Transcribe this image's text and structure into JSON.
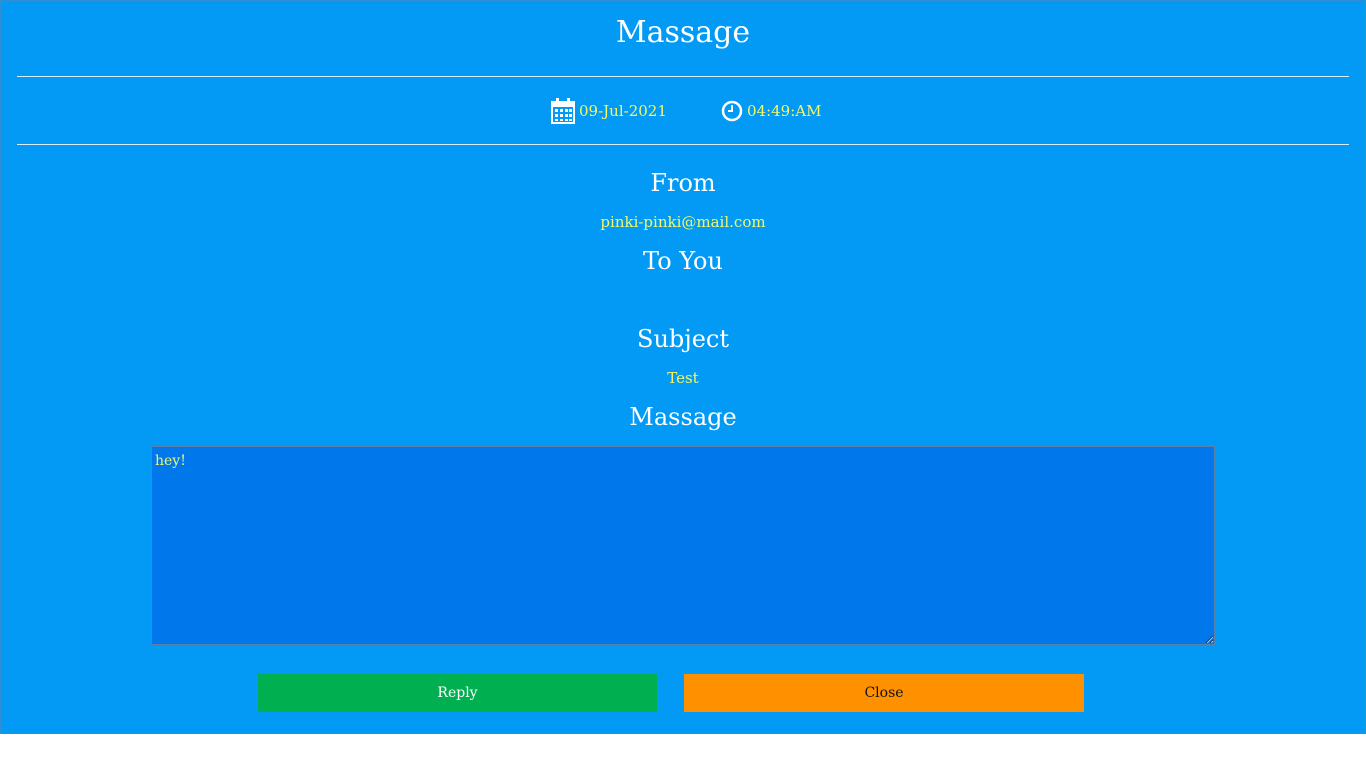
{
  "page": {
    "title": "Massage",
    "date": "09-Jul-2021",
    "time": "04:49:AM",
    "date_icon": "calendar-icon",
    "time_icon": "clock-icon"
  },
  "from": {
    "heading": "From",
    "value": "pinki-pinki@mail.com"
  },
  "to": {
    "heading": "To You",
    "value": ""
  },
  "subject": {
    "heading": "Subject",
    "value": "Test"
  },
  "message": {
    "heading": "Massage",
    "body": "hey!"
  },
  "actions": {
    "reply_label": "Reply",
    "close_label": "Close"
  },
  "colors": {
    "background": "#029af4",
    "highlight_text": "#f4f76a",
    "textarea": "#0078ec",
    "reply": "#00b050",
    "close": "#ff9100"
  }
}
